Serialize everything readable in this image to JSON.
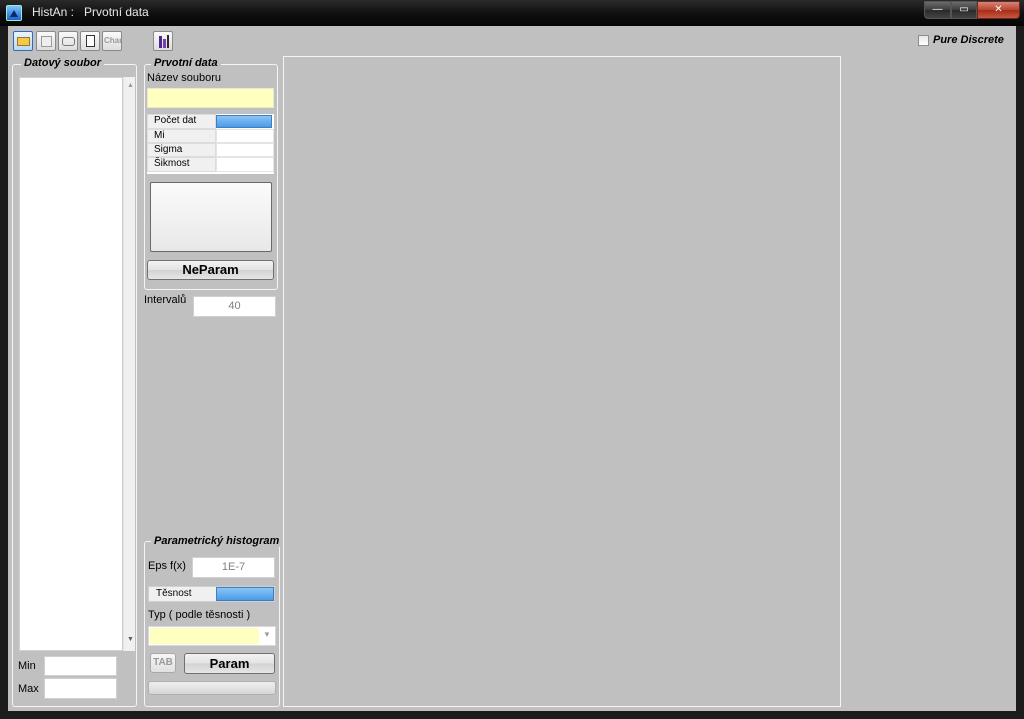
{
  "window": {
    "title": "HistAn :   Prvotní data",
    "minimize": "—",
    "maximize": "▭",
    "close": "✕"
  },
  "toolbar": {
    "char_label": "Char",
    "pure_discrete_label": "Pure Discrete",
    "pure_discrete_checked": false
  },
  "datovy_soubor": {
    "title": "Datový soubor",
    "min_label": "Min",
    "max_label": "Max",
    "min_value": "",
    "max_value": ""
  },
  "prvotni_data": {
    "title": "Prvotní data",
    "file_name_label": "Název souboru",
    "file_name_value": "",
    "stats": [
      {
        "label": "Počet dat",
        "value": ""
      },
      {
        "label": "Mi",
        "value": ""
      },
      {
        "label": "Sigma",
        "value": ""
      },
      {
        "label": "Šikmost",
        "value": ""
      }
    ],
    "neparam_label": "NeParam"
  },
  "intervals": {
    "label": "Intervalů",
    "value": "40"
  },
  "param_histogram": {
    "title": "Parametrický histogram",
    "eps_label": "Eps f(x)",
    "eps_value": "1E-7",
    "tesnost_label": "Těsnost",
    "typ_label": "Typ ( podle těsnosti )",
    "typ_value": "",
    "tab_label": "TAB",
    "param_label": "Param"
  },
  "colors": {
    "client_bg": "#c0c0c0",
    "input_yellow": "#ffffc0",
    "progress_blue": "#4a9be6"
  }
}
